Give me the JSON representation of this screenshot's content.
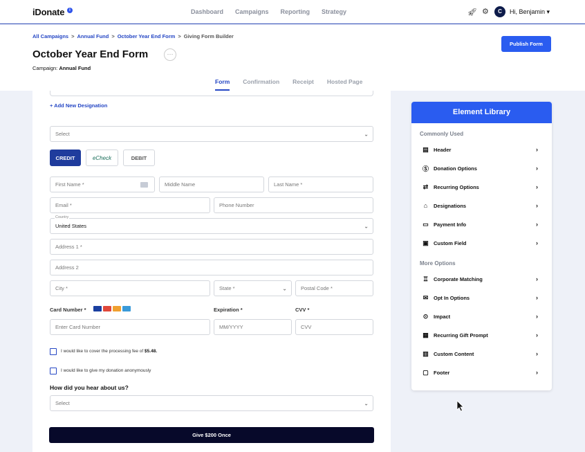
{
  "nav": {
    "logo": "iDonate",
    "logo_info": "i",
    "links": [
      "Dashboard",
      "Campaigns",
      "Reporting",
      "Strategy"
    ],
    "avatar_initial": "C",
    "greeting": "Hi, Benjamin ▾"
  },
  "header": {
    "breadcrumb": [
      "All Campaigns",
      "Annual Fund",
      "October Year End Form",
      "Giving Form Builder"
    ],
    "breadcrumb_sep": ">",
    "title": "October Year End Form",
    "more": "···",
    "campaign_label": "Campaign:",
    "campaign_value": "Annual Fund",
    "publish_label": "Publish Form",
    "tabs": [
      "Form",
      "Confirmation",
      "Receipt",
      "Hosted Page"
    ]
  },
  "form": {
    "add_designation": "+ Add New Designation",
    "select_placeholder": "Select",
    "payment_methods": {
      "credit": "CREDIT",
      "echeck": "eCheck",
      "debit": "DEBIT"
    },
    "first_name": "First Name *",
    "middle_name": "Middle Name",
    "last_name": "Last Name *",
    "email": "Email *",
    "phone": "Phone Number",
    "country_label": "Country",
    "country_value": "United States",
    "address1": "Address 1 *",
    "address2": "Address 2",
    "city": "City *",
    "state": "State *",
    "postal": "Postal Code *",
    "card_number_label": "Card Number *",
    "expiration_label": "Expiration *",
    "cvv_label": "CVV *",
    "card_placeholder": "Enter Card Number",
    "exp_placeholder": "MM/YYYY",
    "cvv_placeholder": "CVV",
    "fee_text": "I would like to cover the processing fee of",
    "fee_amount": "$5.48.",
    "anon_text": "I would like to give my donation anonymously",
    "hear_question": "How did you hear about us?",
    "hear_placeholder": "Select",
    "give_label": "Give $200 Once"
  },
  "library": {
    "title": "Element Library",
    "common_label": "Commonly Used",
    "common": [
      {
        "label": "Header",
        "icon": "header-icon",
        "glyph": "▤"
      },
      {
        "label": "Donation Options",
        "icon": "dollar-icon",
        "glyph": "Ⓢ"
      },
      {
        "label": "Recurring Options",
        "icon": "repeat-icon",
        "glyph": "⇄"
      },
      {
        "label": "Designations",
        "icon": "home-icon",
        "glyph": "⌂"
      },
      {
        "label": "Payment Info",
        "icon": "credit-card-icon",
        "glyph": "▭"
      },
      {
        "label": "Custom Field",
        "icon": "document-icon",
        "glyph": "▣"
      }
    ],
    "more_label": "More Options",
    "more": [
      {
        "label": "Corporate Matching",
        "icon": "bank-icon",
        "glyph": "♖"
      },
      {
        "label": "Opt In Options",
        "icon": "mail-icon",
        "glyph": "✉"
      },
      {
        "label": "Impact",
        "icon": "location-pin-icon",
        "glyph": "⊙"
      },
      {
        "label": "Recurring Gift Prompt",
        "icon": "calendar-icon",
        "glyph": "▦"
      },
      {
        "label": "Custom Content",
        "icon": "message-icon",
        "glyph": "▥"
      },
      {
        "label": "Footer",
        "icon": "footer-icon",
        "glyph": "▢"
      }
    ],
    "arrow": "›"
  }
}
